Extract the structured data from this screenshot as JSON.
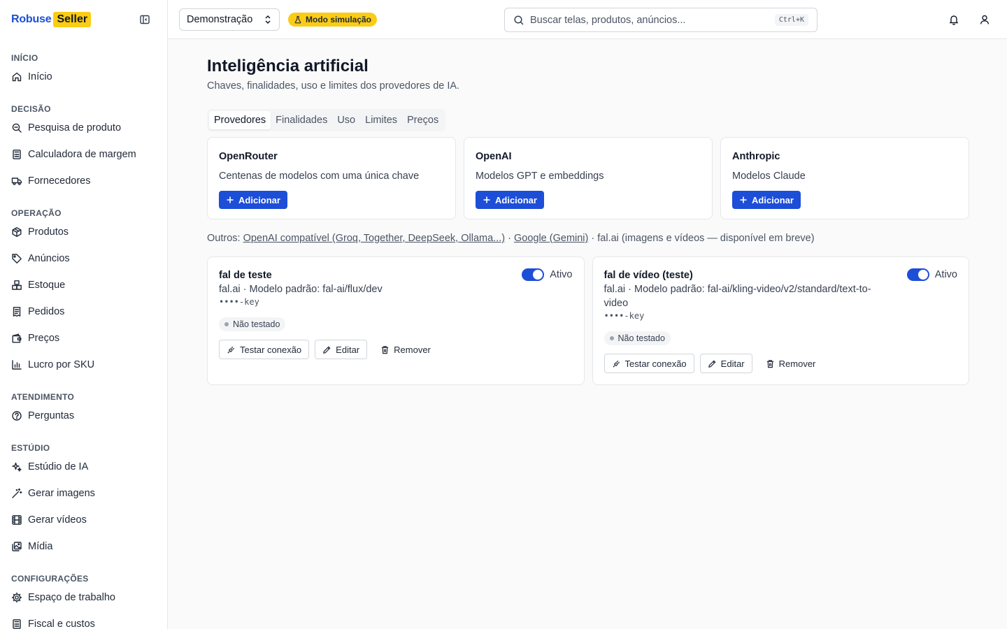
{
  "brand": {
    "part1": "Robuse",
    "part2": "Seller"
  },
  "sidebar": {
    "sections": [
      {
        "title": "INÍCIO",
        "items": [
          {
            "label": "Início",
            "icon": "home-icon"
          }
        ]
      },
      {
        "title": "DECISÃO",
        "items": [
          {
            "label": "Pesquisa de produto",
            "icon": "search-zoom-icon"
          },
          {
            "label": "Calculadora de margem",
            "icon": "calculator-icon"
          },
          {
            "label": "Fornecedores",
            "icon": "truck-icon"
          }
        ]
      },
      {
        "title": "OPERAÇÃO",
        "items": [
          {
            "label": "Produtos",
            "icon": "package-icon"
          },
          {
            "label": "Anúncios",
            "icon": "tag-icon"
          },
          {
            "label": "Estoque",
            "icon": "boxes-icon"
          },
          {
            "label": "Pedidos",
            "icon": "receipt-icon"
          },
          {
            "label": "Preços",
            "icon": "wallet-icon"
          },
          {
            "label": "Lucro por SKU",
            "icon": "bar-chart-icon"
          }
        ]
      },
      {
        "title": "ATENDIMENTO",
        "items": [
          {
            "label": "Perguntas",
            "icon": "help-circle-icon"
          }
        ]
      },
      {
        "title": "ESTÚDIO",
        "items": [
          {
            "label": "Estúdio de IA",
            "icon": "sparkles-icon"
          },
          {
            "label": "Gerar imagens",
            "icon": "wand-icon"
          },
          {
            "label": "Gerar vídeos",
            "icon": "film-icon"
          },
          {
            "label": "Mídia",
            "icon": "images-icon"
          }
        ]
      },
      {
        "title": "CONFIGURAÇÕES",
        "items": [
          {
            "label": "Espaço de trabalho",
            "icon": "gear-icon"
          },
          {
            "label": "Fiscal e custos",
            "icon": "calculator-icon"
          }
        ]
      }
    ]
  },
  "topbar": {
    "org": "Demonstração",
    "sim_badge": "Modo simulação",
    "search_placeholder": "Buscar telas, produtos, anúncios...",
    "shortcut": "Ctrl+K"
  },
  "page": {
    "title": "Inteligência artificial",
    "subtitle": "Chaves, finalidades, uso e limites dos provedores de IA.",
    "tabs": [
      "Provedores",
      "Finalidades",
      "Uso",
      "Limites",
      "Preços"
    ],
    "active_tab": "Provedores"
  },
  "providers": [
    {
      "name": "OpenRouter",
      "desc": "Centenas de modelos com uma única chave",
      "button": "Adicionar"
    },
    {
      "name": "OpenAI",
      "desc": "Modelos GPT e embeddings",
      "button": "Adicionar"
    },
    {
      "name": "Anthropic",
      "desc": "Modelos Claude",
      "button": "Adicionar"
    }
  ],
  "others": {
    "prefix": "Outros:",
    "link1": "OpenAI compatível (Groq, Together, DeepSeek, Ollama...)",
    "sep1": " · ",
    "link2": "Google (Gemini)",
    "rest": " · fal.ai (imagens e vídeos — disponível em breve)"
  },
  "instances": [
    {
      "name": "fal de teste",
      "meta": "fal.ai · Modelo padrão: fal-ai/flux/dev",
      "key": "••••-key",
      "active": true,
      "toggle_label": "Ativo",
      "status": "Não testado",
      "actions": {
        "test": "Testar conexão",
        "edit": "Editar",
        "remove": "Remover"
      }
    },
    {
      "name": "fal de vídeo (teste)",
      "meta": "fal.ai · Modelo padrão: fal-ai/kling-video/v2/standard/text-to-video",
      "key": "••••-key",
      "active": true,
      "toggle_label": "Ativo",
      "status": "Não testado",
      "actions": {
        "test": "Testar conexão",
        "edit": "Editar",
        "remove": "Remover"
      }
    }
  ],
  "colors": {
    "accent": "#1d4ed8",
    "brand_yellow": "#facc15"
  }
}
